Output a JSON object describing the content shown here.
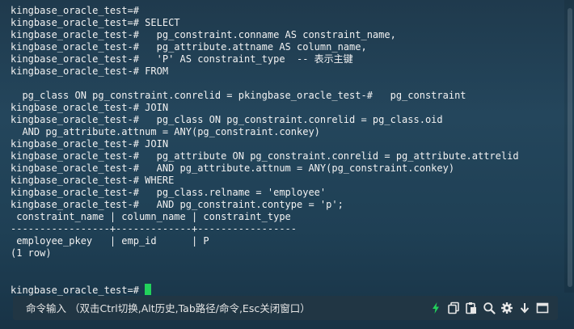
{
  "terminal": {
    "lines": [
      "kingbase_oracle_test=#",
      "kingbase_oracle_test=# SELECT",
      "kingbase_oracle_test-#   pg_constraint.conname AS constraint_name,",
      "kingbase_oracle_test-#   pg_attribute.attname AS column_name,",
      "kingbase_oracle_test-#   'P' AS constraint_type  -- 表示主键",
      "kingbase_oracle_test-# FROM",
      "",
      "  pg_class ON pg_constraint.conrelid = pkingbase_oracle_test-#   pg_constraint",
      "kingbase_oracle_test-# JOIN",
      "kingbase_oracle_test-#   pg_class ON pg_constraint.conrelid = pg_class.oid",
      "  AND pg_attribute.attnum = ANY(pg_constraint.conkey)",
      "kingbase_oracle_test-# JOIN",
      "kingbase_oracle_test-#   pg_attribute ON pg_constraint.conrelid = pg_attribute.attrelid",
      "kingbase_oracle_test-#   AND pg_attribute.attnum = ANY(pg_constraint.conkey)",
      "kingbase_oracle_test-# WHERE",
      "kingbase_oracle_test-#   pg_class.relname = 'employee'",
      "kingbase_oracle_test-#   AND pg_constraint.contype = 'p';",
      " constraint_name | column_name | constraint_type",
      "-----------------+-------------+-----------------",
      " employee_pkey   | emp_id      | P",
      "(1 row)",
      "",
      ""
    ],
    "prompt": "kingbase_oracle_test=# ",
    "cursor_color": "#22d15b"
  },
  "command_bar": {
    "placeholder": "命令输入 （双击Ctrl切换,Alt历史,Tab路径/命令,Esc关闭窗口）"
  },
  "icons": [
    "bolt-icon",
    "copy-icon",
    "paste-icon",
    "search-icon",
    "gear-icon",
    "download-icon",
    "maximize-icon"
  ],
  "colors": {
    "background": "#24465c",
    "text": "#f2f2f2",
    "accent": "#22d15b"
  }
}
